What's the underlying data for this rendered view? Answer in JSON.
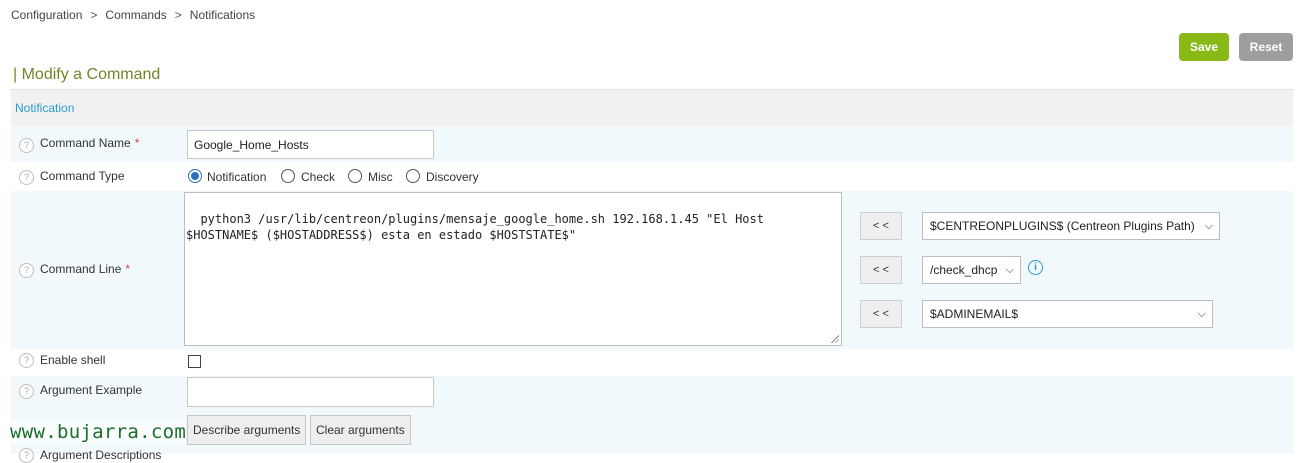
{
  "breadcrumb": {
    "items": [
      "Configuration",
      "Commands",
      "Notifications"
    ],
    "sep": ">"
  },
  "toolbar": {
    "save_label": "Save",
    "reset_label": "Reset",
    "save_color": "#88b917",
    "reset_color": "#9e9e9e"
  },
  "page": {
    "title": "| Modify a Command",
    "section": "Notification"
  },
  "form": {
    "help_glyph": "?",
    "required_mark": "*",
    "command_name": {
      "label": "Command Name",
      "value": "Google_Home_Hosts"
    },
    "command_type": {
      "label": "Command Type",
      "options": [
        "Notification",
        "Check",
        "Misc",
        "Discovery"
      ],
      "selected": "Notification"
    },
    "command_line": {
      "label": "Command Line",
      "value": "python3 /usr/lib/centreon/plugins/mensaje_google_home.sh 192.168.1.45 \"El Host $HOSTNAME$ ($HOSTADDRESS$) esta en estado $HOSTSTATE$\""
    },
    "macros": {
      "insert_label": "< <",
      "plugins_path": "$CENTREONPLUGINS$ (Centreon Plugins Path)",
      "check_command": "/check_dhcp",
      "admin_macro": "$ADMINEMAIL$"
    },
    "enable_shell": {
      "label": "Enable shell",
      "checked": false
    },
    "argument_example": {
      "label": "Argument Example",
      "value": ""
    },
    "buttons": {
      "describe": "Describe arguments",
      "clear": "Clear arguments"
    },
    "argument_descriptions_label": "Argument Descriptions"
  },
  "watermark": "www.bujarra.com"
}
